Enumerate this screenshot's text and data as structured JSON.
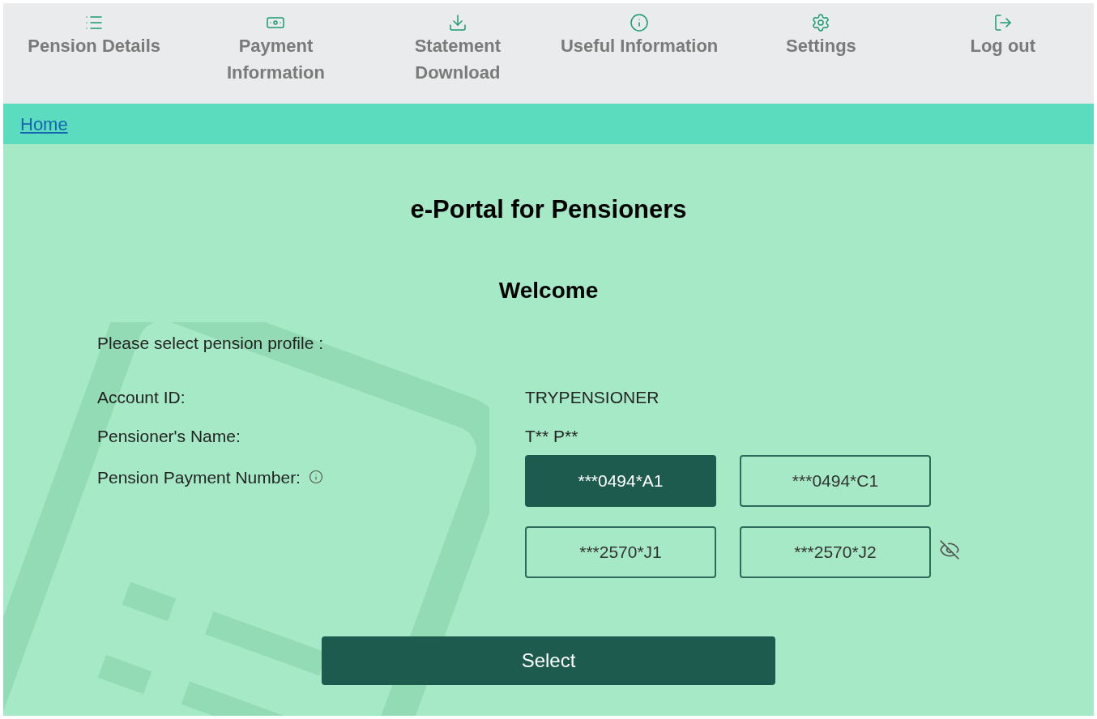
{
  "nav": [
    {
      "label": "Pension Details"
    },
    {
      "label": "Payment Information"
    },
    {
      "label": "Statement Download"
    },
    {
      "label": "Useful Information"
    },
    {
      "label": "Settings"
    },
    {
      "label": "Log out"
    }
  ],
  "breadcrumb": "Home",
  "title": "e-Portal for Pensioners",
  "welcome": "Welcome",
  "prompt": "Please select pension profile :",
  "account_label": "Account ID:",
  "account_value": "TRYPENSIONER",
  "name_label": "Pensioner's Name:",
  "name_value": "T** P**",
  "ppn_label": "Pension Payment Number:",
  "ppn_options": [
    {
      "label": "***0494*A1",
      "selected": true
    },
    {
      "label": "***0494*C1",
      "selected": false
    },
    {
      "label": "***2570*J1",
      "selected": false
    },
    {
      "label": "***2570*J2",
      "selected": false
    }
  ],
  "select_button": "Select"
}
